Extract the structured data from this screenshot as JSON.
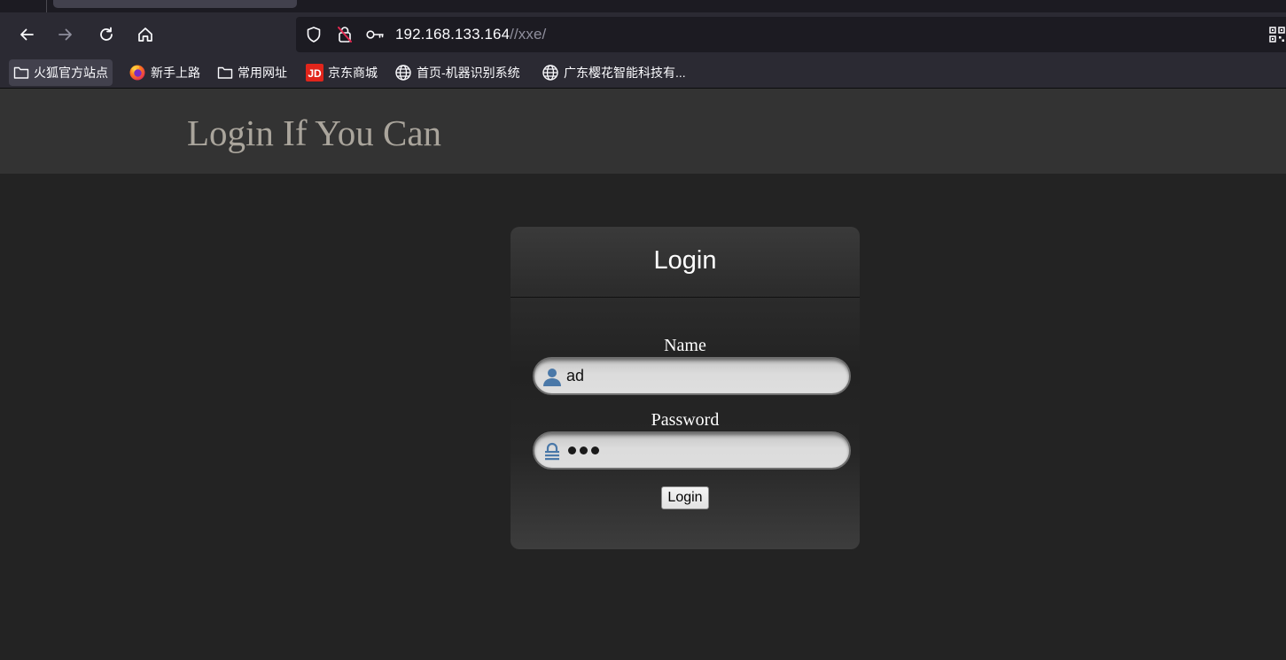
{
  "browser": {
    "url": {
      "host": "192.168.133.164",
      "path": "//xxe/"
    },
    "icons": {
      "back": "arrow-left-icon",
      "forward": "arrow-right-icon",
      "reload": "reload-icon",
      "home": "home-icon",
      "tracking": "shield-icon",
      "insecure": "insecure-lock-icon",
      "password_key": "key-icon",
      "qr": "qr-code-icon"
    },
    "bookmarks": [
      {
        "label": "火狐官方站点",
        "icon": "folder-icon"
      },
      {
        "label": "新手上路",
        "icon": "firefox-icon"
      },
      {
        "label": "常用网址",
        "icon": "folder-icon"
      },
      {
        "label": "京东商城",
        "icon": "jd-icon"
      },
      {
        "label": "首页-机器识别系统",
        "icon": "globe-icon"
      },
      {
        "label": "广东樱花智能科技有...",
        "icon": "globe-icon"
      }
    ]
  },
  "page": {
    "site_title": "Login If You Can",
    "login": {
      "heading": "Login",
      "name_label": "Name",
      "name_value": "ad",
      "password_label": "Password",
      "password_dots": 3,
      "submit_label": "Login"
    }
  },
  "colors": {
    "header_bg": "#333333",
    "page_bg": "#232323",
    "title_color": "#aaa59c",
    "icon_blue": "#4a78a8"
  }
}
